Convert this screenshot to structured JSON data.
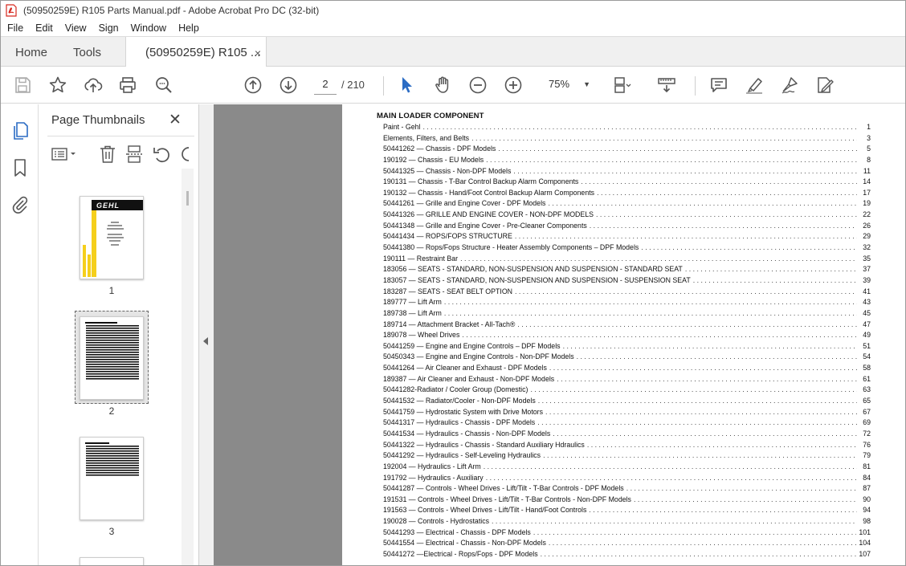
{
  "window": {
    "title": "(50950259E) R105 Parts Manual.pdf - Adobe Acrobat Pro DC (32-bit)"
  },
  "menu": [
    "File",
    "Edit",
    "View",
    "Sign",
    "Window",
    "Help"
  ],
  "tabs": {
    "home": "Home",
    "tools": "Tools",
    "document": "(50950259E) R105 ...",
    "close_glyph": "×"
  },
  "toolbar": {
    "current_page": "2",
    "page_total": "/ 210",
    "zoom": "75%",
    "zoom_chevron": "▼"
  },
  "thumbnail_panel": {
    "title": "Page Thumbnails",
    "close_glyph": "✕",
    "pages": [
      {
        "label": "1",
        "brand": "GEHL"
      },
      {
        "label": "2"
      },
      {
        "label": "3"
      }
    ]
  },
  "colors": {
    "acrobat_red": "#d6281f",
    "select_blue": "#2b6cc4",
    "gehl_yellow": "#f5cf1c",
    "canvas_gray": "#8a8a8a"
  },
  "icons": {
    "toolbar": [
      "save-icon",
      "star-icon",
      "upload-icon",
      "print-icon",
      "zoom-search-icon",
      "page-up-icon",
      "page-down-icon",
      "select-cursor-icon",
      "hand-icon",
      "zoom-out-icon",
      "zoom-in-icon",
      "page-layout-icon",
      "scroll-mode-icon",
      "comment-icon",
      "highlight-icon",
      "sign-icon",
      "edit-pdf-icon"
    ],
    "rail": [
      "pages-icon",
      "bookmark-icon",
      "attachment-icon"
    ]
  },
  "document": {
    "heading": "MAIN LOADER COMPONENT",
    "entries": [
      {
        "title": "Paint - Gehl",
        "page": "1"
      },
      {
        "title": "Elements, Filters, and Belts",
        "page": "3"
      },
      {
        "title": "50441262 — Chassis - DPF Models",
        "page": "5"
      },
      {
        "title": "190192 — Chassis - EU Models",
        "page": "8"
      },
      {
        "title": "50441325 — Chassis - Non-DPF Models",
        "page": "11"
      },
      {
        "title": "190131 — Chassis - T-Bar Control Backup Alarm Components",
        "page": "14"
      },
      {
        "title": "190132 — Chassis - Hand/Foot Control Backup Alarm Components",
        "page": "17"
      },
      {
        "title": "50441261 — Grille and Engine Cover - DPF Models",
        "page": "19"
      },
      {
        "title": "50441326 — GRILLE AND ENGINE COVER - NON-DPF MODELS",
        "page": "22"
      },
      {
        "title": "50441348 — Grille and Engine Cover - Pre-Cleaner Components",
        "page": "26"
      },
      {
        "title": "50441434 — ROPS/FOPS STRUCTURE",
        "page": "29"
      },
      {
        "title": "50441380 — Rops/Fops Structure - Heater Assembly Components – DPF Models",
        "page": "32"
      },
      {
        "title": "190111 — Restraint Bar",
        "page": "35"
      },
      {
        "title": "183056 — SEATS - STANDARD, NON-SUSPENSION AND SUSPENSION - STANDARD SEAT",
        "page": "37"
      },
      {
        "title": "183057 — SEATS - STANDARD, NON-SUSPENSION AND SUSPENSION - SUSPENSION SEAT",
        "page": "39"
      },
      {
        "title": "183287 — SEATS - SEAT BELT OPTION",
        "page": "41"
      },
      {
        "title": "189777 — Lift Arm",
        "page": "43"
      },
      {
        "title": "189738 — Lift Arm",
        "page": "45"
      },
      {
        "title": "189714 — Attachment Bracket - All-Tach®",
        "page": "47"
      },
      {
        "title": "189078 — Wheel Drives",
        "page": "49"
      },
      {
        "title": "50441259 — Engine and Engine Controls – DPF Models",
        "page": "51"
      },
      {
        "title": "50450343 — Engine and Engine Controls - Non-DPF Models",
        "page": "54"
      },
      {
        "title": "50441264 — Air Cleaner and Exhaust - DPF Models",
        "page": "58"
      },
      {
        "title": "189387 — Air Cleaner and Exhaust - Non-DPF Models",
        "page": "61"
      },
      {
        "title": "50441282-Radiator / Cooler Group (Domestic)",
        "page": "63"
      },
      {
        "title": "50441532 — Radiator/Cooler - Non-DPF Models",
        "page": "65"
      },
      {
        "title": "50441759 — Hydrostatic System with Drive Motors",
        "page": "67"
      },
      {
        "title": "50441317 — Hydraulics - Chassis - DPF Models",
        "page": "69"
      },
      {
        "title": "50441534 — Hydraulics - Chassis - Non-DPF Models",
        "page": "72"
      },
      {
        "title": "50441322 — Hydraulics - Chassis - Standard Auxiliary Hdraulics",
        "page": "76"
      },
      {
        "title": "50441292 — Hydraulics - Self-Leveling Hydraulics",
        "page": "79"
      },
      {
        "title": "192004 — Hydraulics - Lift Arm",
        "page": "81"
      },
      {
        "title": "191792 — Hydraulics - Auxiliary",
        "page": "84"
      },
      {
        "title": "50441287 — Controls - Wheel Drives - Lift/Tilt - T-Bar Controls - DPF Models",
        "page": "87"
      },
      {
        "title": "191531 — Controls - Wheel Drives - Lift/Tilt - T-Bar Controls - Non-DPF Models",
        "page": "90"
      },
      {
        "title": "191563 — Controls - Wheel Drives - Lift/Tilt - Hand/Foot Controls",
        "page": "94"
      },
      {
        "title": "190028 — Controls - Hydrostatics",
        "page": "98"
      },
      {
        "title": "50441293 — Electrical - Chassis - DPF Models",
        "page": "101"
      },
      {
        "title": "50441554 — Electrical - Chassis - Non-DPF Models",
        "page": "104"
      },
      {
        "title": "50441272 —Electrical - Rops/Fops - DPF Models",
        "page": "107"
      }
    ]
  }
}
